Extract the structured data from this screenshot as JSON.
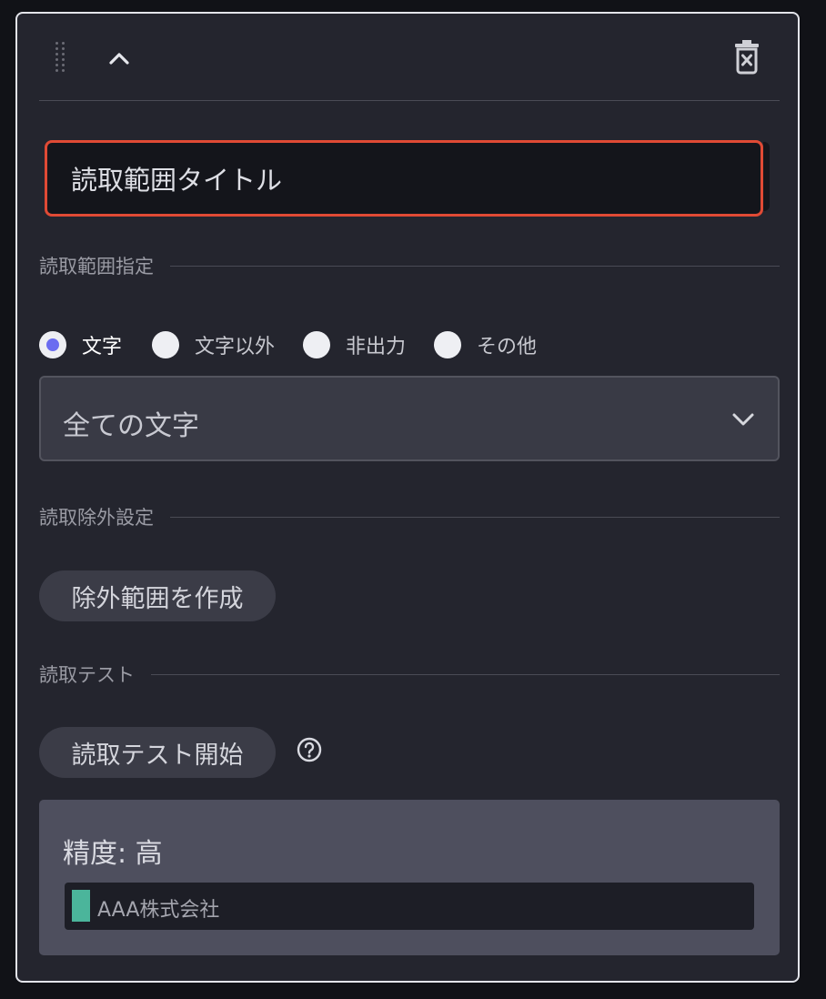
{
  "title_input": {
    "value": "読取範囲タイトル"
  },
  "range_section": {
    "label": "読取範囲指定",
    "options": [
      {
        "label": "文字",
        "selected": true
      },
      {
        "label": "文字以外",
        "selected": false
      },
      {
        "label": "非出力",
        "selected": false
      },
      {
        "label": "その他",
        "selected": false
      }
    ],
    "select_value": "全ての文字"
  },
  "exclusion_section": {
    "label": "読取除外設定",
    "button_label": "除外範囲を作成"
  },
  "test_section": {
    "label": "読取テスト",
    "button_label": "読取テスト開始"
  },
  "result": {
    "accuracy": "精度: 高",
    "text": "AAA株式会社"
  },
  "colors": {
    "accent": "#6a6cf0",
    "focus_border": "#e04a35",
    "result_swatch": "#4bb59b"
  },
  "icons": [
    "drag-handle-icon",
    "chevron-up-icon",
    "trash-icon",
    "chevron-down-icon",
    "help-circle-icon"
  ]
}
